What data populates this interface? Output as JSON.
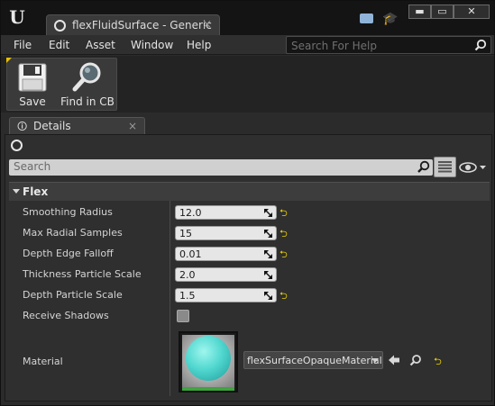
{
  "window": {
    "tab_title": "flexFluidSurface - Generic",
    "tab_close": "×",
    "controls": {
      "minimize": "▬",
      "maximize": "▭",
      "close": "✕"
    },
    "logo_icon": "unreal-logo-icon",
    "logo_text": "U"
  },
  "menu": {
    "items": [
      "File",
      "Edit",
      "Asset",
      "Window",
      "Help"
    ],
    "help_search_placeholder": "Search For Help"
  },
  "toolbar": {
    "save_label": "Save",
    "find_label": "Find in CB"
  },
  "details": {
    "tab_label": "Details",
    "tab_close": "×",
    "search_placeholder": "Search",
    "category": "Flex",
    "properties": [
      {
        "label": "Smoothing Radius",
        "value": "12.0",
        "reset": true
      },
      {
        "label": "Max Radial Samples",
        "value": "15",
        "reset": true
      },
      {
        "label": "Depth Edge Falloff",
        "value": "0.01",
        "reset": true
      },
      {
        "label": "Thickness Particle Scale",
        "value": "2.0",
        "reset": false
      },
      {
        "label": "Depth Particle Scale",
        "value": "1.5",
        "reset": true
      }
    ],
    "receive_shadows": {
      "label": "Receive Shadows",
      "checked": false
    },
    "material": {
      "label": "Material",
      "value": "flexSurfaceOpaqueMaterial"
    }
  },
  "colors": {
    "reset_arrow": "#e8d000",
    "sphere": "#52d8d0",
    "accent_corner": "#e8c000"
  }
}
